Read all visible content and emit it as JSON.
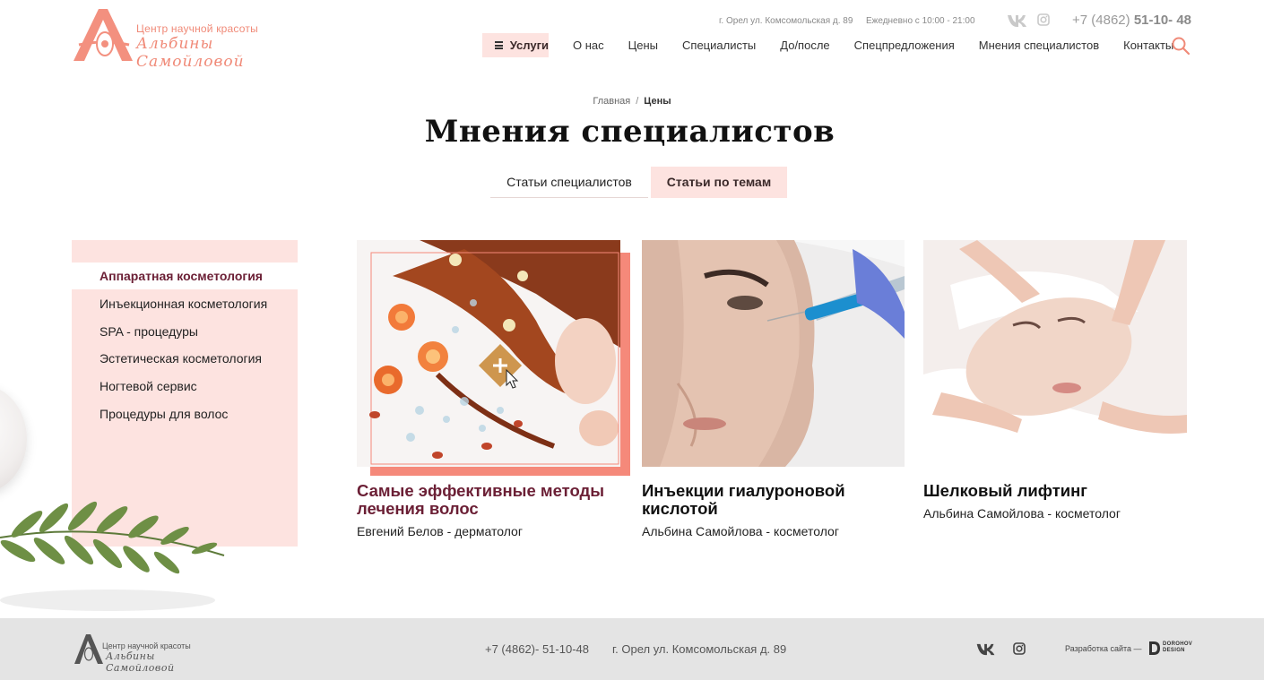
{
  "brand": {
    "line1": "Центр научной красоты",
    "line2": "Альбины Самойловой",
    "accent_color": "#f08a78"
  },
  "header": {
    "address": "г. Орел ул. Комсомольская д. 89",
    "hours": "Ежедневно с 10:00 - 21:00",
    "phone_prefix": "+7 (4862)",
    "phone_number": "51-10- 48",
    "social_icons": [
      "vk-icon",
      "instagram-icon"
    ]
  },
  "nav": {
    "services": "Услуги",
    "items": [
      "О нас",
      "Цены",
      "Специалисты",
      "До/после",
      "Спецпредложения",
      "Мнения специалистов",
      "Контакты"
    ]
  },
  "breadcrumb": {
    "home": "Главная",
    "separator": "/",
    "current": "Цены"
  },
  "page_title": "Мнения специалистов",
  "tabs": [
    {
      "label": "Статьи специалистов",
      "active": false
    },
    {
      "label": "Статьи по темам",
      "active": true
    }
  ],
  "sidebar": {
    "items": [
      "Аппаратная косметология",
      "Инъекционная косметология",
      "SPA - процедуры",
      "Эстетическая косметология",
      "Ногтевой сервис",
      "Процедуры для волос"
    ],
    "active_index": 0
  },
  "cards": [
    {
      "title": "Самые эффективные методы лечения волос",
      "author": "Евгений Белов - дерматолог",
      "image": "hair-treatment-photo"
    },
    {
      "title": "Инъекции гиалуроновой кислотой",
      "author": "Альбина Самойлова - косметолог",
      "image": "hyaluronic-injection-photo"
    },
    {
      "title": "Шелковый лифтинг",
      "author": "Альбина Самойлова - косметолог",
      "image": "face-massage-photo"
    }
  ],
  "footer": {
    "phone": "+7 (4862)- 51-10-48",
    "address": "г. Орел ул. Комсомольская д. 89",
    "developer_label": "Разработка сайта —",
    "developer_brand_line1": "DOROHOV",
    "developer_brand_line2": "DESIGN"
  },
  "colors": {
    "pink_bg": "#fde3e0",
    "burgundy": "#6b1f35",
    "coral": "#f5897a",
    "footer_bg": "#e4e4e4"
  }
}
